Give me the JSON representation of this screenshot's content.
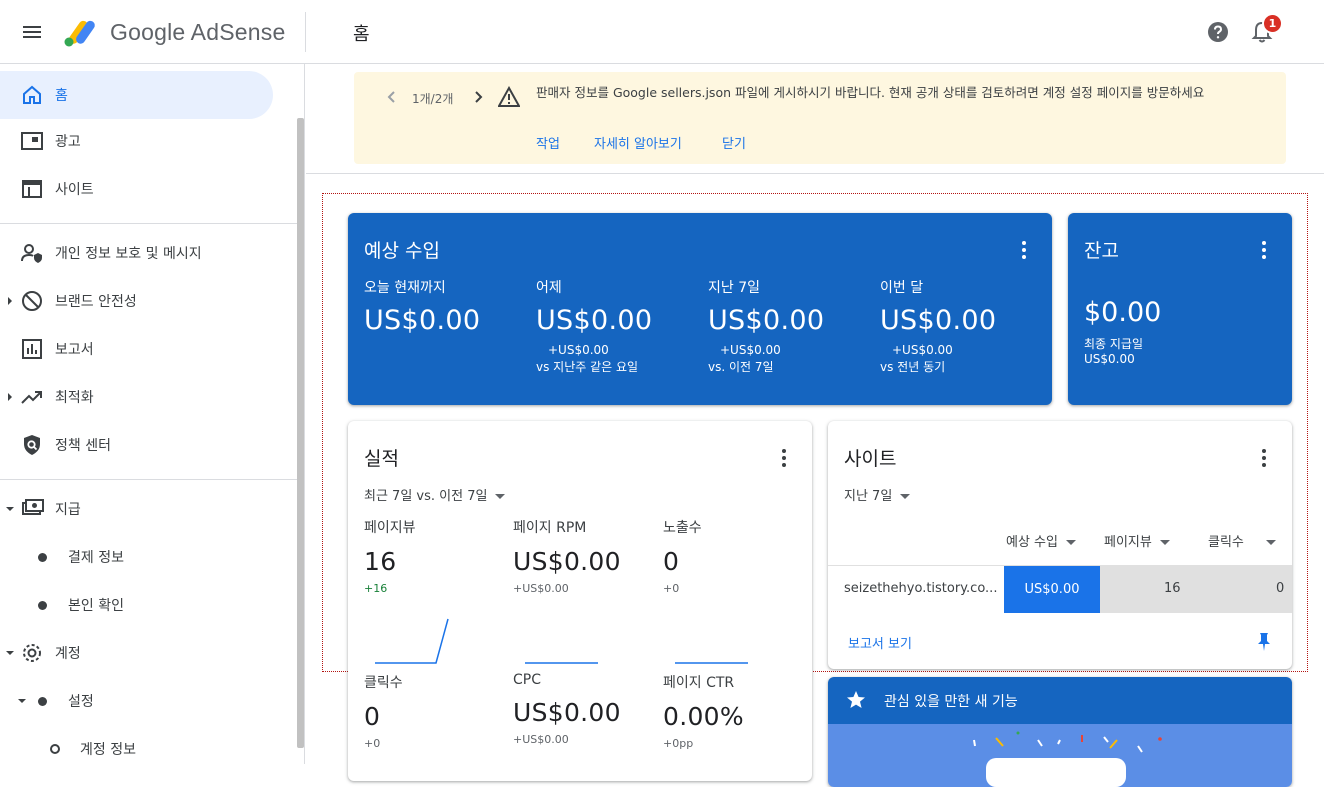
{
  "app": {
    "product_name": "Google AdSense",
    "page_title": "홈",
    "notification_count": "1"
  },
  "sidebar": {
    "items": [
      {
        "label": "홈"
      },
      {
        "label": "광고"
      },
      {
        "label": "사이트"
      },
      {
        "label": "개인 정보 보호 및 메시지"
      },
      {
        "label": "브랜드 안전성"
      },
      {
        "label": "보고서"
      },
      {
        "label": "최적화"
      },
      {
        "label": "정책 센터"
      },
      {
        "label": "지급"
      },
      {
        "label": "결제 정보"
      },
      {
        "label": "본인 확인"
      },
      {
        "label": "계정"
      },
      {
        "label": "설정"
      },
      {
        "label": "계정 정보"
      }
    ]
  },
  "banner": {
    "pager": "1개/2개",
    "message": "판매자 정보를 Google sellers.json 파일에 게시하시기 바랍니다. 현재 공개 상태를 검토하려면 계정 설정 페이지를 방문하세요",
    "action": "작업",
    "learn_more": "자세히 알아보기",
    "close": "닫기"
  },
  "estimated": {
    "title": "예상 수입",
    "columns": [
      {
        "label": "오늘 현재까지",
        "value": "US$0.00",
        "delta": "",
        "compare": ""
      },
      {
        "label": "어제",
        "value": "US$0.00",
        "delta": "+US$0.00",
        "compare": "vs 지난주 같은 요일"
      },
      {
        "label": "지난 7일",
        "value": "US$0.00",
        "delta": "+US$0.00",
        "compare": "vs. 이전 7일"
      },
      {
        "label": "이번 달",
        "value": "US$0.00",
        "delta": "+US$0.00",
        "compare": "vs 전년 동기"
      }
    ]
  },
  "balance": {
    "title": "잔고",
    "value": "$0.00",
    "last_payment_label": "최종 지급일",
    "last_payment_value": "US$0.00"
  },
  "performance": {
    "title": "실적",
    "range": "최근 7일 vs. 이전 7일",
    "metrics": [
      {
        "label": "페이지뷰",
        "value": "16",
        "delta": "+16"
      },
      {
        "label": "페이지 RPM",
        "value": "US$0.00",
        "delta": "+US$0.00"
      },
      {
        "label": "노출수",
        "value": "0",
        "delta": "+0"
      },
      {
        "label": "클릭수",
        "value": "0",
        "delta": "+0"
      },
      {
        "label": "CPC",
        "value": "US$0.00",
        "delta": "+US$0.00"
      },
      {
        "label": "페이지 CTR",
        "value": "0.00%",
        "delta": "+0pp"
      }
    ]
  },
  "sites": {
    "title": "사이트",
    "range": "지난 7일",
    "columns": [
      "예상 수입",
      "페이지뷰",
      "클릭수"
    ],
    "rows": [
      {
        "site": "seizethehyo.tistory.co...",
        "revenue": "US$0.00",
        "pageviews": "16",
        "clicks": "0"
      }
    ],
    "report_link": "보고서 보기"
  },
  "new_features": {
    "title": "관심 있을 만한 새 기능"
  },
  "colors": {
    "brand_blue": "#1565c0",
    "link_blue": "#1a73e8",
    "banner_bg": "#fef7e0",
    "badge_red": "#d93025"
  }
}
